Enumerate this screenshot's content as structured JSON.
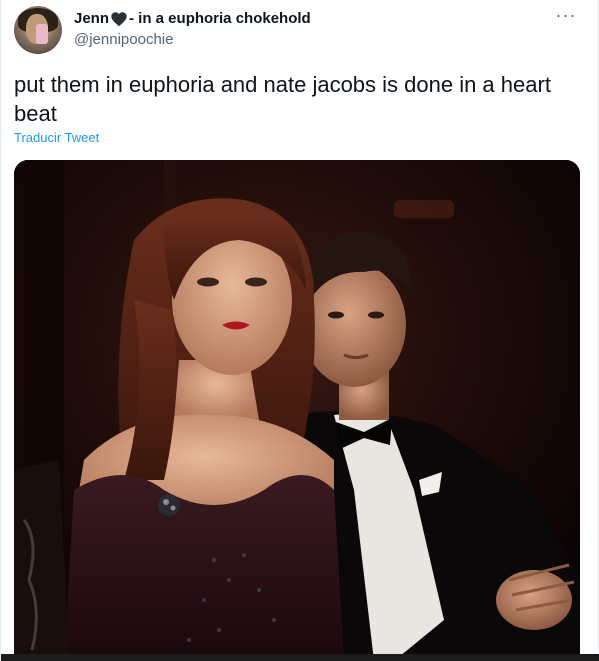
{
  "tweet": {
    "display_name_part1": "Jenn",
    "display_name_part2": "- in a euphoria chokehold",
    "handle": "@jennipoochie",
    "text": "put them in euphoria and nate jacobs is done in a heart beat",
    "translate_label": "Traducir Tweet",
    "more_label": "···",
    "heart_icon": "black-heart-icon",
    "avatar_icon": "user-avatar",
    "media_description": "photo",
    "colors": {
      "link": "#1d9bf0",
      "text": "#0f1419",
      "secondary": "#536471"
    }
  }
}
